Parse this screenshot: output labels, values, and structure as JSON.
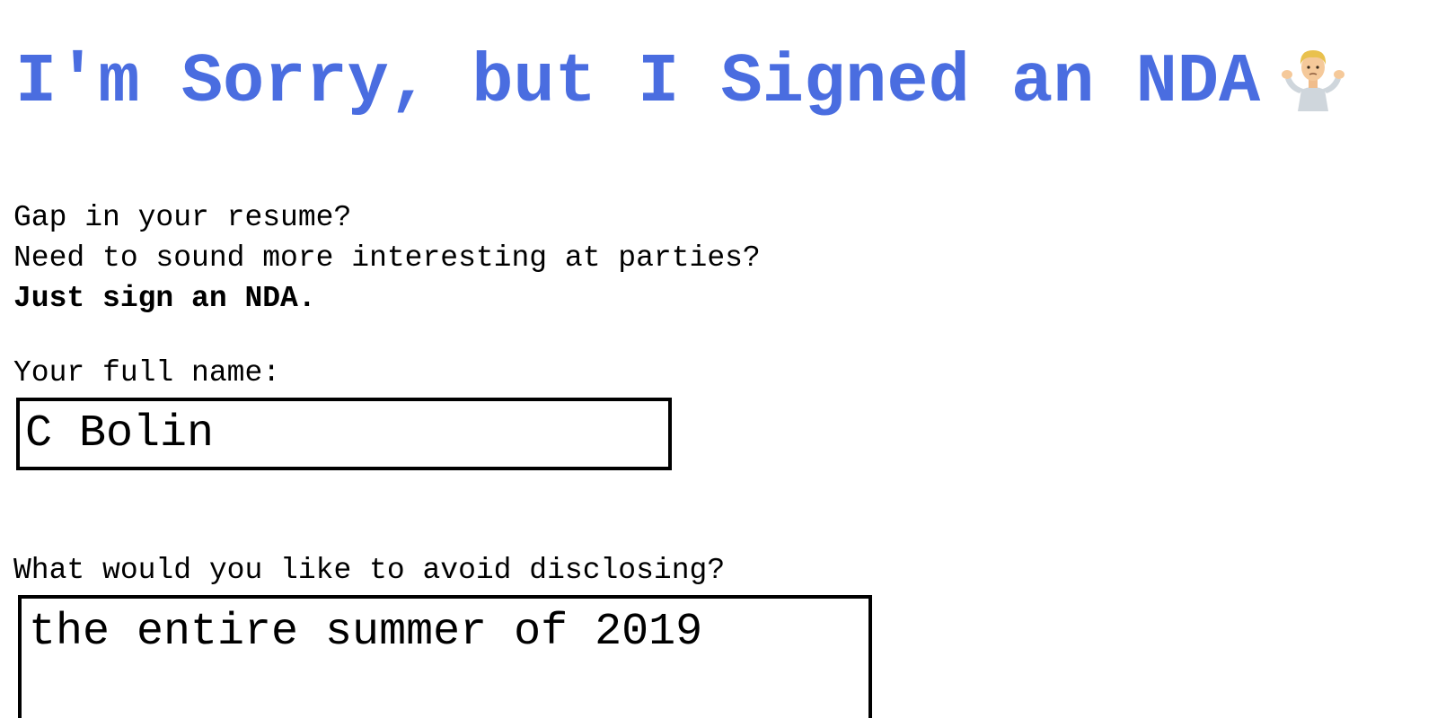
{
  "header": {
    "title": "I'm Sorry, but I Signed an NDA",
    "title_color": "#4a6de0",
    "title_icon": "person-shrugging-icon"
  },
  "intro": {
    "line1": "Gap in your resume?",
    "line2": "Need to sound more interesting at parties?",
    "line3": "Just sign an NDA."
  },
  "form": {
    "name_label": "Your full name:",
    "name_value": "C Bolin",
    "secret_label": "What would you like to avoid disclosing?",
    "secret_value": "the entire summer of 2019"
  }
}
